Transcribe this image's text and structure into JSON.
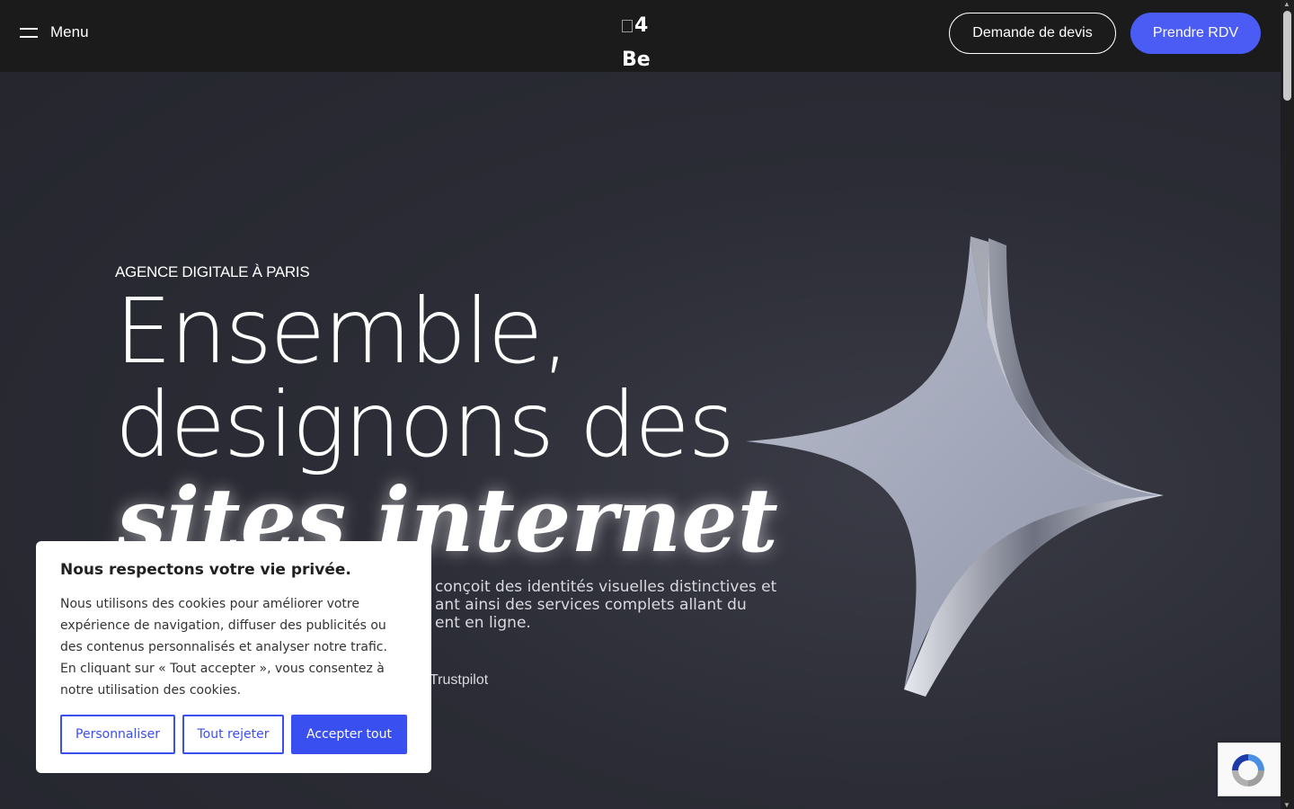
{
  "header": {
    "menu_label": "Menu",
    "logo_alt": "4 Be",
    "quote_button": "Demande de devis",
    "appointment_button": "Prendre RDV"
  },
  "hero": {
    "kicker": "AGENCE DIGITALE À PARIS",
    "title_line1": "Ensemble,",
    "title_line2": "designons des",
    "title_line3": "sites internet",
    "description": "conçoit des identités visuelles distinctives et\nant ainsi des services complets allant du\nent en ligne.",
    "trustpilot": "Trustpilot"
  },
  "cookie_banner": {
    "title": "Nous respectons votre vie privée.",
    "body": "Nous utilisons des cookies pour améliorer votre expérience de navigation, diffuser des publicités ou des contenus personnalisés et analyser notre trafic. En cliquant sur « Tout accepter », vous consentez à notre utilisation des cookies.",
    "customize": "Personnaliser",
    "reject": "Tout rejeter",
    "accept": "Accepter tout"
  },
  "colors": {
    "accent": "#4a5cf4",
    "cookie_accent": "#3a4ff0",
    "header_bg": "#1b1b1b"
  }
}
